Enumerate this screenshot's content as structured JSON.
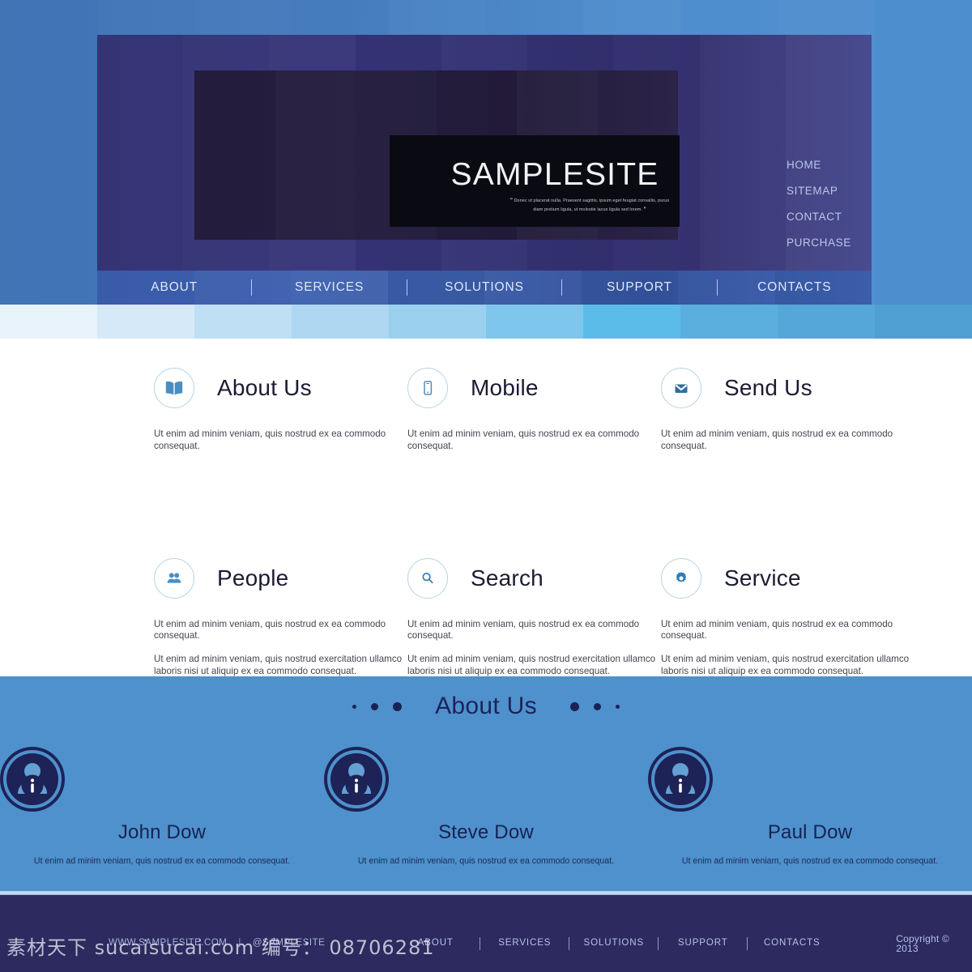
{
  "header": {
    "logo_text": "SAMPLESITE",
    "tagline": "Donec ut placerat nulla. Praesent sagittis, ipsum eget feugiat convallis, purus diam pretium ligula, ut molestie lacus ligula sed lorem.",
    "quote_open": "”",
    "quote_close": "”",
    "top_nav": [
      {
        "label": "HOME"
      },
      {
        "label": "SITEMAP"
      },
      {
        "label": "CONTACT"
      },
      {
        "label": "PURCHASE"
      }
    ],
    "main_nav": [
      {
        "label": "ABOUT"
      },
      {
        "label": "SERVICES"
      },
      {
        "label": "SOLUTIONS"
      },
      {
        "label": "SUPPORT"
      },
      {
        "label": "CONTACTS"
      }
    ]
  },
  "features": [
    {
      "icon": "book-icon",
      "title": "About Us",
      "paragraphs": [
        "Ut enim ad minim veniam, quis nostrud ex ea commodo consequat."
      ]
    },
    {
      "icon": "mobile-phone-icon",
      "title": "Mobile",
      "paragraphs": [
        "Ut enim ad minim veniam, quis nostrud ex ea commodo consequat."
      ]
    },
    {
      "icon": "envelope-icon",
      "title": "Send Us",
      "paragraphs": [
        "Ut enim ad minim veniam, quis nostrud ex ea commodo consequat."
      ]
    },
    {
      "icon": "people-icon",
      "title": "People",
      "paragraphs": [
        "Ut enim ad minim veniam, quis nostrud ex ea commodo consequat.",
        "Ut enim ad minim veniam, quis nostrud exercitation ullamco laboris nisi ut aliquip ex ea commodo consequat."
      ]
    },
    {
      "icon": "search-icon",
      "title": "Search",
      "paragraphs": [
        "Ut enim ad minim veniam, quis nostrud ex ea commodo consequat.",
        "Ut enim ad minim veniam, quis nostrud exercitation ullamco laboris nisi ut aliquip ex ea commodo consequat."
      ]
    },
    {
      "icon": "gear-icon",
      "title": "Service",
      "paragraphs": [
        "Ut enim ad minim veniam, quis nostrud ex ea commodo consequat.",
        "Ut enim ad minim veniam, quis nostrud exercitation ullamco laboris nisi ut aliquip ex ea commodo consequat."
      ]
    }
  ],
  "team": {
    "title": "About Us",
    "members": [
      {
        "avatar": "user-info-avatar-icon",
        "name": "John Dow",
        "bio": "Ut enim ad minim veniam, quis nostrud ex ea commodo consequat."
      },
      {
        "avatar": "user-info-avatar-icon",
        "name": "Steve Dow",
        "bio": "Ut enim ad minim veniam, quis nostrud ex ea commodo consequat."
      },
      {
        "avatar": "user-info-avatar-icon",
        "name": "Paul Dow",
        "bio": "Ut enim ad minim veniam, quis nostrud ex ea commodo consequat."
      }
    ]
  },
  "footer": {
    "site_url": "WWW.SAMPLESITE.COM",
    "separator": "|",
    "social_handle": "@SAMPLESITE",
    "nav": [
      {
        "label": "ABOUT"
      },
      {
        "label": "SERVICES"
      },
      {
        "label": "SOLUTIONS"
      },
      {
        "label": "SUPPORT"
      },
      {
        "label": "CONTACTS"
      }
    ],
    "copyright": "Copyright © 2013"
  },
  "watermark": {
    "text": "素材天下 sucaisucai.com 编号： 08706281"
  },
  "colors": {
    "header_blue": "#4079bd",
    "panel_purple": "#343475",
    "hero_dark": "#231c3c",
    "nav_blue": "#3a5ba8",
    "team_blue": "#4e91cd",
    "footer_purple": "#2c2a5e",
    "icon_blue": "#4a8ec4",
    "navy_text": "#1b2256"
  }
}
